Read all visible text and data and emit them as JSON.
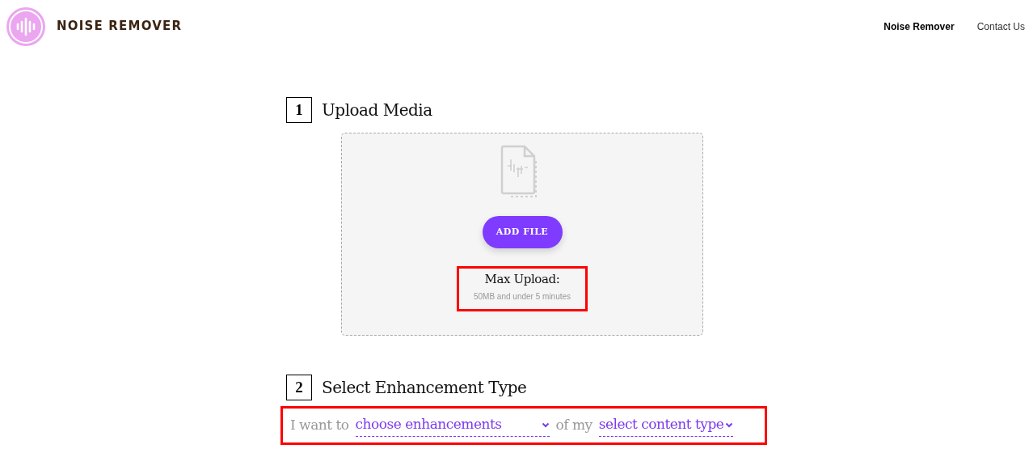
{
  "header": {
    "brand": "NOISE REMOVER",
    "nav": [
      {
        "label": "Noise Remover",
        "selected": true
      },
      {
        "label": "Contact Us",
        "selected": false
      }
    ]
  },
  "steps": [
    {
      "number": "1",
      "title": "Upload Media"
    },
    {
      "number": "2",
      "title": "Select Enhancement Type"
    }
  ],
  "upload": {
    "button": "ADD FILE",
    "limit_title": "Max Upload:",
    "limit_detail": "50MB and under 5 minutes"
  },
  "enhancement": {
    "prefix": "I want to",
    "enhancement_select": "choose enhancements",
    "middle": "of my",
    "content_select": "select content type"
  }
}
